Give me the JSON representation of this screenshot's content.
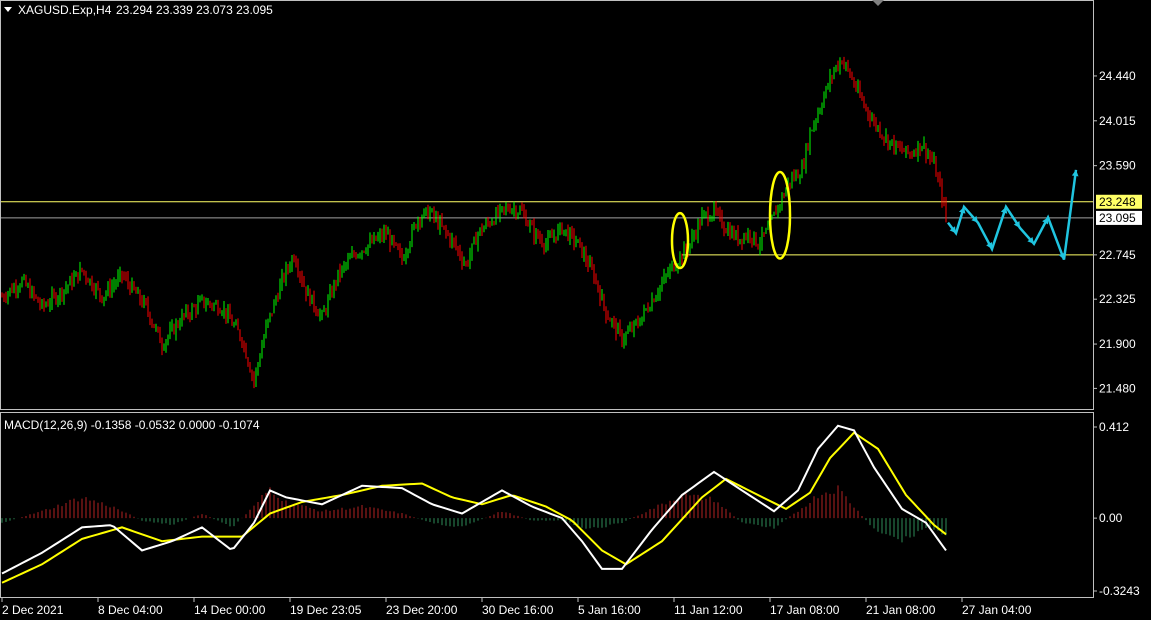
{
  "colors": {
    "background": "#000000",
    "border": "#c0c0c0",
    "bull": "#00ff00",
    "bear": "#ff0000",
    "macd_main": "#ffffff",
    "macd_signal": "#ffff00",
    "hist_pos": "#b22222",
    "hist_neg": "#2e8b57",
    "level_line": "#ffff66",
    "bid_line": "#a0a0a0",
    "marker": "#ffff00",
    "projection": "#20c5e0"
  },
  "icons": {
    "menu": "triangle-down-icon"
  },
  "chart_data": [
    {
      "type": "candlestick",
      "title": "XAGUSD.Exp,H4",
      "ohlc_text": "23.294 23.339 23.073 23.095",
      "x_labels": [
        "2 Dec 2021",
        "8 Dec 04:00",
        "14 Dec 00:00",
        "19 Dec 23:05",
        "23 Dec 20:00",
        "30 Dec 16:00",
        "5 Jan 16:00",
        "11 Jan 12:00",
        "17 Jan 08:00",
        "21 Jan 08:00",
        "27 Jan 04:00"
      ],
      "y_ticks": [
        "24.440",
        "24.015",
        "23.590",
        "23.248",
        "23.095",
        "22.745",
        "22.325",
        "21.900",
        "21.480"
      ],
      "ylim": [
        21.37,
        24.97
      ],
      "levels": {
        "upper": 23.248,
        "bid": 23.095,
        "lower": 22.745
      },
      "close_path": [
        [
          0,
          22.35
        ],
        [
          10,
          22.5
        ],
        [
          20,
          22.25
        ],
        [
          30,
          22.4
        ],
        [
          40,
          22.6
        ],
        [
          50,
          22.35
        ],
        [
          60,
          22.55
        ],
        [
          72,
          22.25
        ],
        [
          80,
          21.9
        ],
        [
          90,
          22.15
        ],
        [
          100,
          22.3
        ],
        [
          110,
          22.25
        ],
        [
          120,
          21.95
        ],
        [
          126,
          21.55
        ],
        [
          132,
          22.05
        ],
        [
          140,
          22.5
        ],
        [
          146,
          22.75
        ],
        [
          152,
          22.4
        ],
        [
          160,
          22.15
        ],
        [
          168,
          22.55
        ],
        [
          176,
          22.75
        ],
        [
          184,
          22.85
        ],
        [
          192,
          22.95
        ],
        [
          200,
          22.7
        ],
        [
          208,
          23.1
        ],
        [
          214,
          23.15
        ],
        [
          220,
          23.0
        ],
        [
          226,
          22.85
        ],
        [
          232,
          22.65
        ],
        [
          238,
          22.95
        ],
        [
          246,
          23.1
        ],
        [
          254,
          23.2
        ],
        [
          260,
          23.15
        ],
        [
          266,
          22.95
        ],
        [
          272,
          22.85
        ],
        [
          280,
          23.0
        ],
        [
          288,
          22.85
        ],
        [
          296,
          22.55
        ],
        [
          302,
          22.2
        ],
        [
          310,
          21.95
        ],
        [
          318,
          22.1
        ],
        [
          326,
          22.35
        ],
        [
          334,
          22.6
        ],
        [
          340,
          22.75
        ],
        [
          344,
          22.85
        ],
        [
          350,
          23.1
        ],
        [
          356,
          23.15
        ],
        [
          362,
          23.0
        ],
        [
          368,
          22.9
        ],
        [
          374,
          22.95
        ],
        [
          378,
          22.85
        ],
        [
          382,
          22.95
        ],
        [
          388,
          23.2
        ],
        [
          394,
          23.45
        ],
        [
          400,
          23.55
        ],
        [
          404,
          23.9
        ],
        [
          410,
          24.2
        ],
        [
          416,
          24.5
        ],
        [
          420,
          24.6
        ],
        [
          424,
          24.45
        ],
        [
          430,
          24.2
        ],
        [
          436,
          24.0
        ],
        [
          442,
          23.85
        ],
        [
          448,
          23.75
        ],
        [
          454,
          23.7
        ],
        [
          460,
          23.8
        ],
        [
          466,
          23.6
        ],
        [
          470,
          23.3
        ],
        [
          472,
          23.095
        ]
      ],
      "markers": [
        {
          "x_bar": 340,
          "y_center": 22.88,
          "height": 0.52
        },
        {
          "x_bar": 390,
          "y_center": 23.12,
          "height": 0.82
        }
      ],
      "projection": [
        [
          473,
          23.05
        ],
        [
          477,
          22.95
        ],
        [
          481,
          23.2
        ],
        [
          488,
          23.05
        ],
        [
          495,
          22.8
        ],
        [
          502,
          23.2
        ],
        [
          509,
          23.0
        ],
        [
          516,
          22.85
        ],
        [
          523,
          23.1
        ],
        [
          531,
          22.7
        ],
        [
          537,
          23.55
        ]
      ]
    },
    {
      "type": "macd",
      "title": "MACD(12,26,9) -0.1358 -0.0532 0.0000 -0.1074",
      "y_ticks": [
        "0.412",
        "0.00",
        "-0.3243"
      ],
      "ylim": [
        -0.3243,
        0.412
      ],
      "main_path": [
        [
          0,
          -0.24
        ],
        [
          20,
          -0.15
        ],
        [
          40,
          -0.04
        ],
        [
          55,
          -0.03
        ],
        [
          70,
          -0.14
        ],
        [
          85,
          -0.1
        ],
        [
          100,
          -0.04
        ],
        [
          115,
          -0.14
        ],
        [
          126,
          -0.02
        ],
        [
          134,
          0.12
        ],
        [
          142,
          0.09
        ],
        [
          160,
          0.06
        ],
        [
          180,
          0.14
        ],
        [
          200,
          0.13
        ],
        [
          215,
          0.06
        ],
        [
          230,
          0.02
        ],
        [
          250,
          0.12
        ],
        [
          265,
          0.05
        ],
        [
          280,
          0.0
        ],
        [
          290,
          -0.1
        ],
        [
          300,
          -0.22
        ],
        [
          310,
          -0.22
        ],
        [
          325,
          -0.05
        ],
        [
          340,
          0.1
        ],
        [
          356,
          0.2
        ],
        [
          370,
          0.12
        ],
        [
          386,
          0.03
        ],
        [
          398,
          0.12
        ],
        [
          408,
          0.3
        ],
        [
          418,
          0.4
        ],
        [
          426,
          0.38
        ],
        [
          436,
          0.22
        ],
        [
          450,
          0.04
        ],
        [
          462,
          -0.02
        ],
        [
          472,
          -0.14
        ]
      ],
      "signal_path": [
        [
          0,
          -0.28
        ],
        [
          20,
          -0.2
        ],
        [
          40,
          -0.09
        ],
        [
          60,
          -0.04
        ],
        [
          80,
          -0.1
        ],
        [
          100,
          -0.08
        ],
        [
          120,
          -0.08
        ],
        [
          134,
          0.02
        ],
        [
          150,
          0.07
        ],
        [
          170,
          0.1
        ],
        [
          190,
          0.14
        ],
        [
          210,
          0.15
        ],
        [
          225,
          0.09
        ],
        [
          240,
          0.06
        ],
        [
          255,
          0.1
        ],
        [
          272,
          0.05
        ],
        [
          285,
          -0.01
        ],
        [
          300,
          -0.14
        ],
        [
          312,
          -0.2
        ],
        [
          330,
          -0.1
        ],
        [
          350,
          0.09
        ],
        [
          362,
          0.17
        ],
        [
          378,
          0.1
        ],
        [
          392,
          0.04
        ],
        [
          404,
          0.11
        ],
        [
          414,
          0.26
        ],
        [
          426,
          0.37
        ],
        [
          438,
          0.3
        ],
        [
          452,
          0.1
        ],
        [
          466,
          -0.03
        ],
        [
          472,
          -0.07
        ]
      ],
      "histogram_path": [
        [
          0,
          -0.02
        ],
        [
          20,
          0.03
        ],
        [
          40,
          0.09
        ],
        [
          55,
          0.05
        ],
        [
          70,
          -0.01
        ],
        [
          85,
          -0.03
        ],
        [
          100,
          0.02
        ],
        [
          115,
          -0.04
        ],
        [
          126,
          0.05
        ],
        [
          134,
          0.13
        ],
        [
          142,
          0.07
        ],
        [
          160,
          0.03
        ],
        [
          180,
          0.05
        ],
        [
          200,
          0.02
        ],
        [
          215,
          -0.02
        ],
        [
          230,
          -0.04
        ],
        [
          250,
          0.03
        ],
        [
          265,
          -0.01
        ],
        [
          280,
          -0.01
        ],
        [
          290,
          -0.04
        ],
        [
          300,
          -0.04
        ],
        [
          310,
          -0.02
        ],
        [
          325,
          0.04
        ],
        [
          340,
          0.1
        ],
        [
          356,
          0.08
        ],
        [
          370,
          -0.02
        ],
        [
          386,
          -0.04
        ],
        [
          398,
          0.03
        ],
        [
          408,
          0.1
        ],
        [
          418,
          0.13
        ],
        [
          426,
          0.05
        ],
        [
          436,
          -0.05
        ],
        [
          450,
          -0.1
        ],
        [
          462,
          -0.04
        ],
        [
          472,
          -0.07
        ]
      ]
    }
  ]
}
